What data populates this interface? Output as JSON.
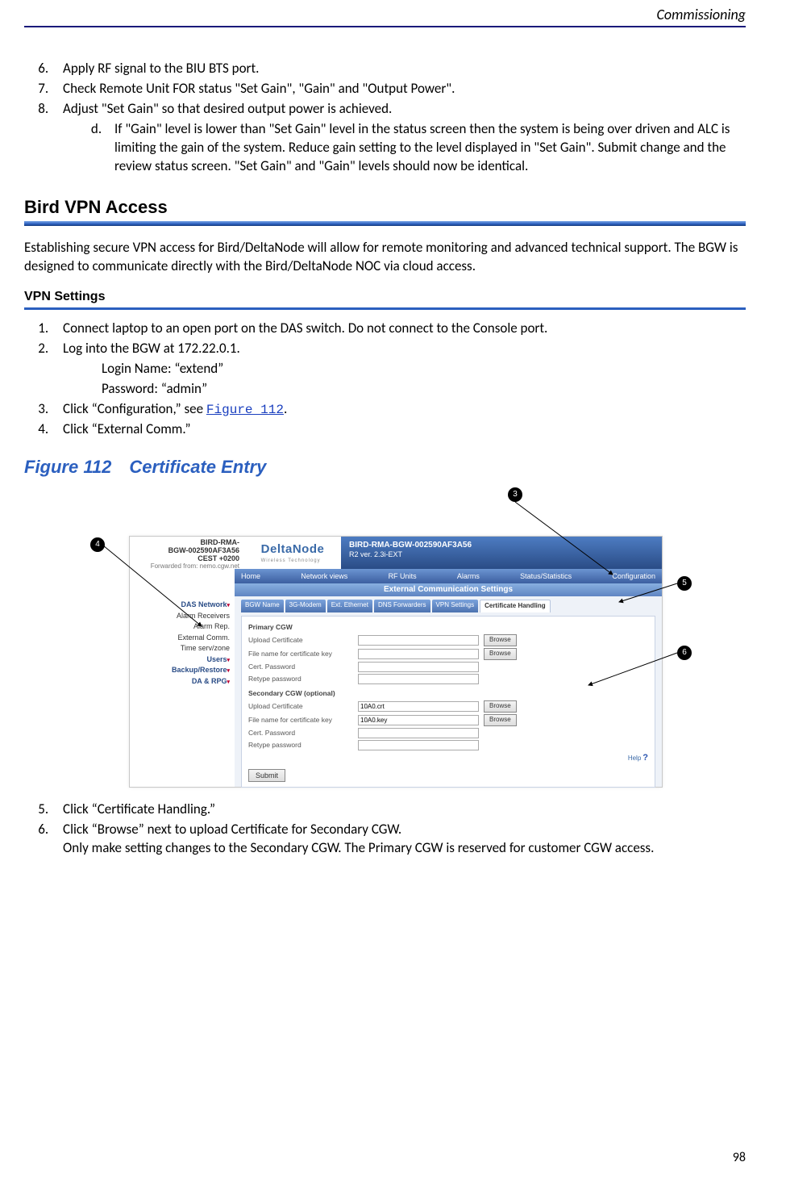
{
  "header": {
    "section": "Commissioning"
  },
  "page_number": "98",
  "steps_a": [
    {
      "n": "6",
      "text": "Apply RF signal to the BIU BTS port."
    },
    {
      "n": "7",
      "text": "Check Remote Unit FOR status \"Set Gain\", \"Gain\" and \"Output Power\"."
    },
    {
      "n": "8",
      "text": "Adjust \"Set Gain\" so that desired output power is achieved."
    }
  ],
  "substep_d": "If \"Gain\" level is lower than \"Set Gain\" level in the status screen then the system is being over driven and ALC is limiting the gain of the system.  Reduce gain setting to the level displayed in \"Set Gain\".  Submit change and the review status screen.  \"Set Gain\" and \"Gain\" levels should now be identical.",
  "h2": "Bird VPN Access",
  "vpn_intro": "Establishing secure VPN access for Bird/DeltaNode will allow for remote monitoring and advanced technical support. The BGW is designed to communicate directly with the Bird/DeltaNode NOC via cloud access.",
  "h3": "VPN Settings",
  "vpn_steps": {
    "s1": "Connect laptop to an open port on the DAS switch. Do not connect to the Console port.",
    "s2": "Log into the BGW at 172.22.0.1.",
    "login_name": "Login Name: “extend”",
    "password": "Password: “admin”",
    "s3_pre": "Click “Configuration,” see ",
    "s3_link": "Figure 112",
    "s3_post": ".",
    "s4": "Click “External Comm.”"
  },
  "fig_caption": "Figure 112 Certificate Entry",
  "callouts": {
    "c3": "3",
    "c4": "4",
    "c5": "5",
    "c6": "6"
  },
  "bgw": {
    "id_line1": "BIRD-RMA-",
    "id_line2": "BGW-002590AF3A56",
    "id_line3": "CEST +0200",
    "fwd": "Forwarded from: nemo.cgw.net",
    "brand": "DeltaNode",
    "brand_sub": "Wireless Technology",
    "title": "BIRD-RMA-BGW-002590AF3A56",
    "title_sub": "R2 ver. 2.3i-EXT",
    "nav": [
      "Home",
      "Network views",
      "RF Units",
      "Alarms",
      "Status/Statistics",
      "Configuration"
    ],
    "subbar": "External Communication Settings",
    "sidebar": {
      "das": "DAS Network",
      "alarm_rx": "Alarm Receivers",
      "alarm_rep": "Alarm Rep.",
      "ext_comm": "External Comm.",
      "time": "Time serv/zone",
      "users": "Users",
      "backup": "Backup/Restore",
      "da": "DA & RPG"
    },
    "tabs": [
      "BGW Name",
      "3G-Modem",
      "Ext. Ethernet",
      "DNS Forwarders",
      "VPN Settings",
      "Certificate Handling"
    ],
    "primary_title": "Primary CGW",
    "secondary_title": "Secondary CGW (optional)",
    "lbl_upload": "Upload Certificate",
    "lbl_keyfile": "File name for certificate key",
    "lbl_certpw": "Cert. Password",
    "lbl_retype": "Retype password",
    "sec_upload_val": "10A0.crt",
    "sec_key_val": "10A0.key",
    "browse": "Browse",
    "submit": "Submit",
    "help": "Help"
  },
  "steps_b": {
    "s5": "Click “Certificate Handling.”",
    "s6": "Click “Browse” next to upload Certificate for Secondary CGW.",
    "s6b": "Only make setting changes to the Secondary CGW. The Primary CGW is reserved for customer CGW access."
  }
}
